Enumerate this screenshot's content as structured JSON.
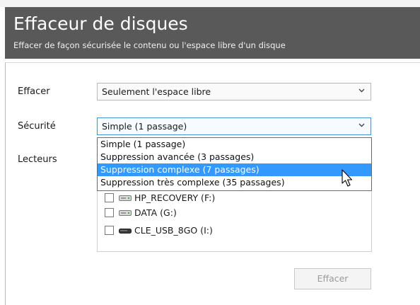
{
  "header": {
    "title": "Effaceur de disques",
    "subtitle": "Effacer de façon sécurisée le contenu ou l'espace libre d'un disque"
  },
  "form": {
    "erase_label": "Effacer",
    "erase_value": "Seulement l'espace libre",
    "security_label": "Sécurité",
    "security_value": "Simple (1 passage)",
    "drives_label": "Lecteurs"
  },
  "security_options": [
    {
      "label": "Simple (1 passage)",
      "selected": false
    },
    {
      "label": "Suppression avancée (3 passages)",
      "selected": false
    },
    {
      "label": "Suppression complexe (7 passages)",
      "selected": true
    },
    {
      "label": "Suppression très complexe (35 passages)",
      "selected": false
    }
  ],
  "drives": [
    {
      "label": "HP_RECOVERY (F:)",
      "checked": false,
      "icon": "hard-drive-icon"
    },
    {
      "label": "DATA (G:)",
      "checked": false,
      "icon": "hard-drive-icon"
    },
    {
      "label": "CLE_USB_8GO (I:)",
      "checked": false,
      "icon": "usb-drive-icon"
    }
  ],
  "actions": {
    "erase_button": "Effacer",
    "erase_button_enabled": false
  },
  "colors": {
    "header_bg": "#595959",
    "selection": "#3399ff",
    "focus_border": "#3f93d8"
  }
}
